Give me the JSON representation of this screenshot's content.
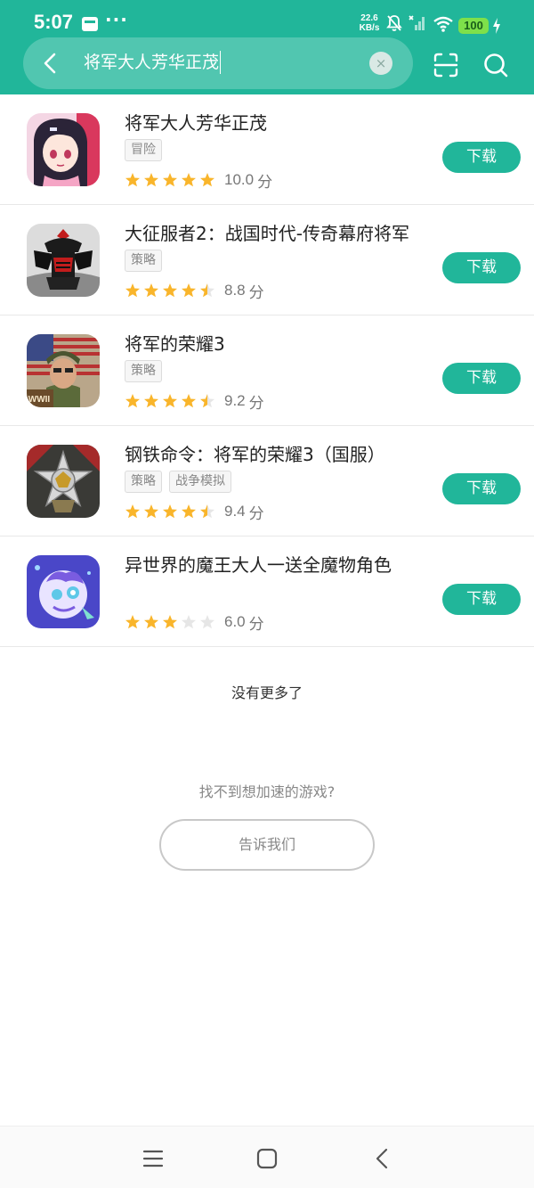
{
  "status_bar": {
    "time": "5:07",
    "more": "···",
    "net_speed_value": "22.6",
    "net_speed_unit": "KB/s",
    "battery": "100"
  },
  "search": {
    "query": "将军大人芳华正茂",
    "clear": "×"
  },
  "games": [
    {
      "title": "将军大人芳华正茂",
      "tags": [
        "冒险"
      ],
      "rating": 5,
      "score": "10.0",
      "unit": "分",
      "action": "下载",
      "icon": "anime-girl-icon"
    },
    {
      "title": "大征服者2：战国时代-传奇幕府将军",
      "tags": [
        "策略"
      ],
      "rating": 4.5,
      "score": "8.8",
      "unit": "分",
      "action": "下载",
      "icon": "samurai-helmet-icon"
    },
    {
      "title": "将军的荣耀3",
      "tags": [
        "策略"
      ],
      "rating": 4.5,
      "score": "9.2",
      "unit": "分",
      "action": "下载",
      "icon": "ww2-general-icon",
      "icon_text": "WWII"
    },
    {
      "title": "钢铁命令：将军的荣耀3（国服）",
      "tags": [
        "策略",
        "战争模拟"
      ],
      "rating": 4.5,
      "score": "9.4",
      "unit": "分",
      "action": "下载",
      "icon": "military-medal-icon"
    },
    {
      "title": "异世界的魔王大人一送全魔物角色",
      "tags": [],
      "rating": 3,
      "score": "6.0",
      "unit": "分",
      "action": "下载",
      "icon": "monster-character-icon"
    }
  ],
  "footer": {
    "no_more": "没有更多了",
    "not_found": "找不到想加速的游戏?",
    "tell_us": "告诉我们"
  },
  "colors": {
    "accent": "#21b69a",
    "star": "#f9b52b",
    "star_empty": "#e6e6e6"
  }
}
